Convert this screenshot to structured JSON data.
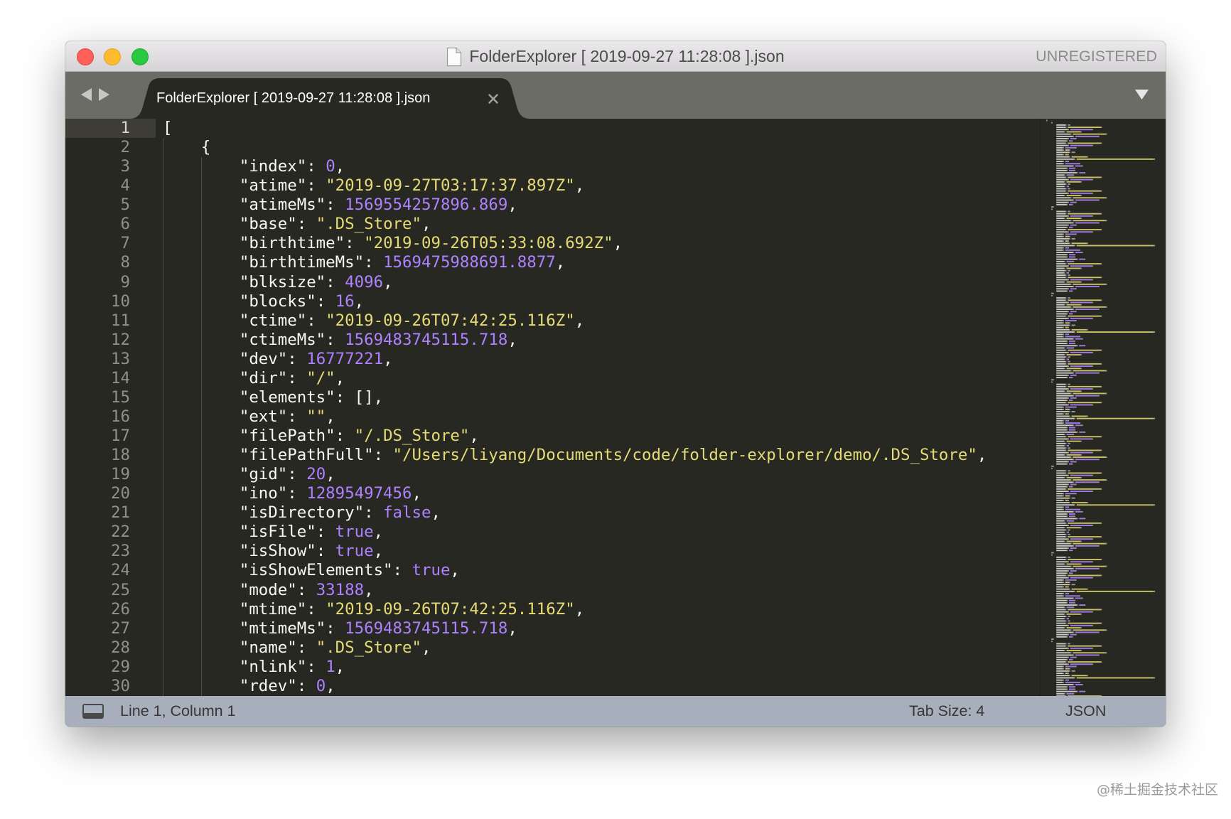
{
  "window": {
    "title": "FolderExplorer [ 2019-09-27 11:28:08 ].json",
    "license_status": "UNREGISTERED"
  },
  "tabs": [
    {
      "label": "FolderExplorer [ 2019-09-27 11:28:08 ].json",
      "active": true
    }
  ],
  "editor": {
    "active_line": 1,
    "lines": [
      {
        "n": "1",
        "text": "["
      },
      {
        "n": "2",
        "text": "    {"
      },
      {
        "n": "3",
        "text": "        \"index\": 0,"
      },
      {
        "n": "4",
        "text": "        \"atime\": \"2019-09-27T03:17:37.897Z\","
      },
      {
        "n": "5",
        "text": "        \"atimeMs\": 1569554257896.869,"
      },
      {
        "n": "6",
        "text": "        \"base\": \".DS_Store\","
      },
      {
        "n": "7",
        "text": "        \"birthtime\": \"2019-09-26T05:33:08.692Z\","
      },
      {
        "n": "8",
        "text": "        \"birthtimeMs\": 1569475988691.8877,"
      },
      {
        "n": "9",
        "text": "        \"blksize\": 4096,"
      },
      {
        "n": "10",
        "text": "        \"blocks\": 16,"
      },
      {
        "n": "11",
        "text": "        \"ctime\": \"2019-09-26T07:42:25.116Z\","
      },
      {
        "n": "12",
        "text": "        \"ctimeMs\": 1569483745115.718,"
      },
      {
        "n": "13",
        "text": "        \"dev\": 16777221,"
      },
      {
        "n": "14",
        "text": "        \"dir\": \"/\","
      },
      {
        "n": "15",
        "text": "        \"elements\": [],"
      },
      {
        "n": "16",
        "text": "        \"ext\": \"\","
      },
      {
        "n": "17",
        "text": "        \"filePath\": \"/.DS_Store\","
      },
      {
        "n": "18",
        "text": "        \"filePathFull\": \"/Users/liyang/Documents/code/folder-explorer/demo/.DS_Store\","
      },
      {
        "n": "19",
        "text": "        \"gid\": 20,"
      },
      {
        "n": "20",
        "text": "        \"ino\": 12895497456,"
      },
      {
        "n": "21",
        "text": "        \"isDirectory\": false,"
      },
      {
        "n": "22",
        "text": "        \"isFile\": true,"
      },
      {
        "n": "23",
        "text": "        \"isShow\": true,"
      },
      {
        "n": "24",
        "text": "        \"isShowElements\": true,"
      },
      {
        "n": "25",
        "text": "        \"mode\": 33188,"
      },
      {
        "n": "26",
        "text": "        \"mtime\": \"2019-09-26T07:42:25.116Z\","
      },
      {
        "n": "27",
        "text": "        \"mtimeMs\": 1569483745115.718,"
      },
      {
        "n": "28",
        "text": "        \"name\": \".DS_Store\","
      },
      {
        "n": "29",
        "text": "        \"nlink\": 1,"
      },
      {
        "n": "30",
        "text": "        \"rdev\": 0,"
      }
    ]
  },
  "status_bar": {
    "position": "Line 1, Column 1",
    "tab_size": "Tab Size: 4",
    "syntax": "JSON"
  },
  "watermark": "@稀土掘金技术社区",
  "theme": {
    "background": "#272822",
    "gutter_text": "#90908a",
    "text": "#f8f8f2",
    "string": "#e6db74",
    "constant": "#ae81ff",
    "tab_bar": "#6b6c66",
    "status_bar": "#a8afbc"
  },
  "icons": {
    "title": "document-icon",
    "tab_nav_back": "triangle-left-icon",
    "tab_nav_forward": "triangle-right-icon",
    "tab_close": "close-icon",
    "tab_list": "triangle-down-icon",
    "panel_toggle": "panel-icon"
  }
}
